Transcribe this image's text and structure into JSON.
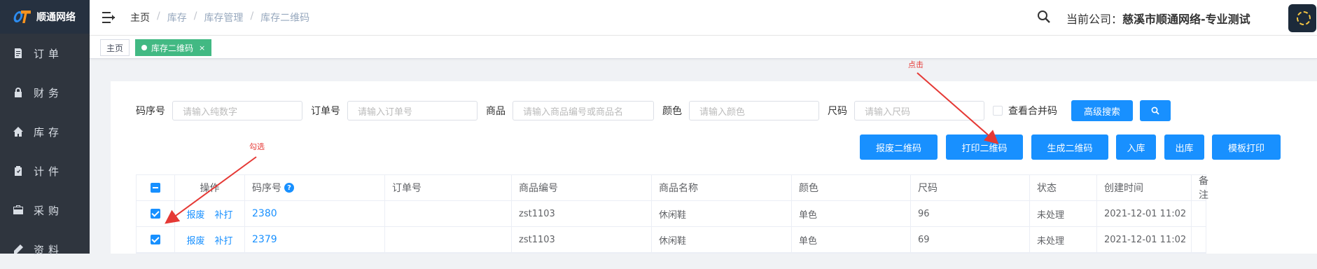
{
  "sidebar": {
    "logo_text": "顺通网络",
    "items": [
      {
        "label": "订单",
        "icon": "order-icon"
      },
      {
        "label": "财务",
        "icon": "lock-icon"
      },
      {
        "label": "库存",
        "icon": "home-icon"
      },
      {
        "label": "计件",
        "icon": "clipboard-icon"
      },
      {
        "label": "采购",
        "icon": "briefcase-icon"
      },
      {
        "label": "资料",
        "icon": "pen-icon"
      }
    ]
  },
  "header": {
    "breadcrumb": [
      "主页",
      "库存",
      "库存管理",
      "库存二维码"
    ],
    "company_label": "当前公司：",
    "company_name": "慈溪市顺通网络-专业测试"
  },
  "tags": [
    {
      "label": "主页",
      "active": false
    },
    {
      "label": "库存二维码",
      "active": true,
      "close": "×"
    }
  ],
  "filters": {
    "code_label": "码序号",
    "code_placeholder": "请输入纯数字",
    "order_label": "订单号",
    "order_placeholder": "请输入订单号",
    "product_label": "商品",
    "product_placeholder": "请输入商品编号或商品名",
    "color_label": "颜色",
    "color_placeholder": "请输入颜色",
    "size_label": "尺码",
    "size_placeholder": "请输入尺码",
    "merge_label": "查看合并码",
    "advanced_search": "高级搜索"
  },
  "actions": [
    "报废二维码",
    "打印二维码",
    "生成二维码",
    "入库",
    "出库",
    "模板打印"
  ],
  "table": {
    "headers": [
      "操作",
      "码序号",
      "订单号",
      "商品编号",
      "商品名称",
      "颜色",
      "尺码",
      "状态",
      "创建时间",
      "备注"
    ],
    "row_actions": [
      "报废",
      "补打"
    ],
    "rows": [
      {
        "code": "2380",
        "order": "",
        "sku": "zst1103",
        "name": "休闲鞋",
        "color": "单色",
        "size": "96",
        "status": "未处理",
        "created": "2021-12-01 11:02",
        "note": ""
      },
      {
        "code": "2379",
        "order": "",
        "sku": "zst1103",
        "name": "休闲鞋",
        "color": "单色",
        "size": "69",
        "status": "未处理",
        "created": "2021-12-01 11:02",
        "note": ""
      }
    ]
  },
  "annotations": {
    "click": "点击",
    "check": "勾选"
  },
  "colors": {
    "sidebar": "#2f353e",
    "primary": "#1890ff",
    "tag_active": "#42b983",
    "annotation": "#e53935"
  }
}
